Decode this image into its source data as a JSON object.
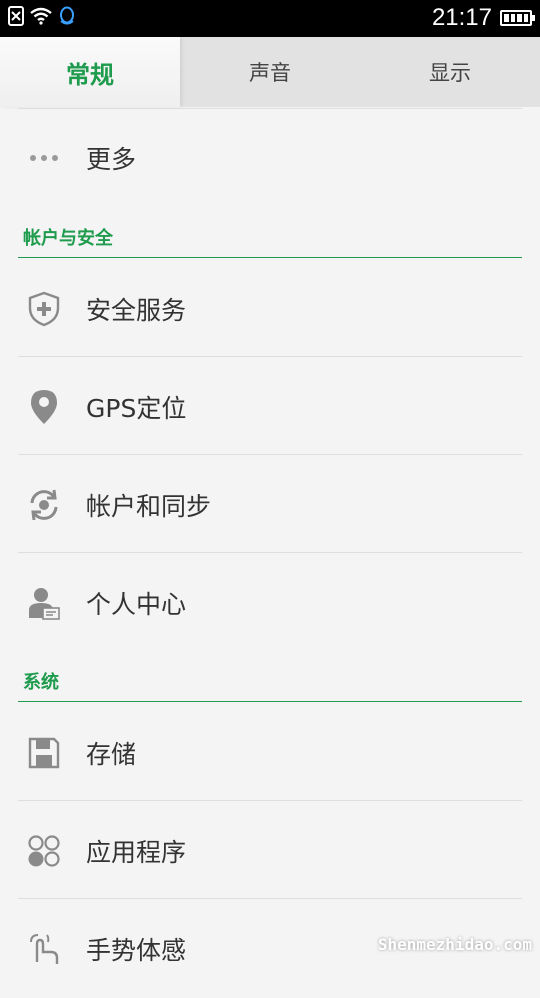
{
  "status_bar": {
    "time": "21:17"
  },
  "tabs": [
    {
      "label": "常规"
    },
    {
      "label": "声音"
    },
    {
      "label": "显示"
    }
  ],
  "items": {
    "more": "更多",
    "security_service": "安全服务",
    "gps": "GPS定位",
    "account_sync": "帐户和同步",
    "personal_center": "个人中心",
    "storage": "存储",
    "applications": "应用程序",
    "gesture": "手势体感"
  },
  "sections": {
    "account_security": "帐户与安全",
    "system": "系统"
  },
  "watermark": "Shenmezhidao.com",
  "colors": {
    "accent": "#1e9b4c",
    "icon": "#8a8a8a"
  }
}
